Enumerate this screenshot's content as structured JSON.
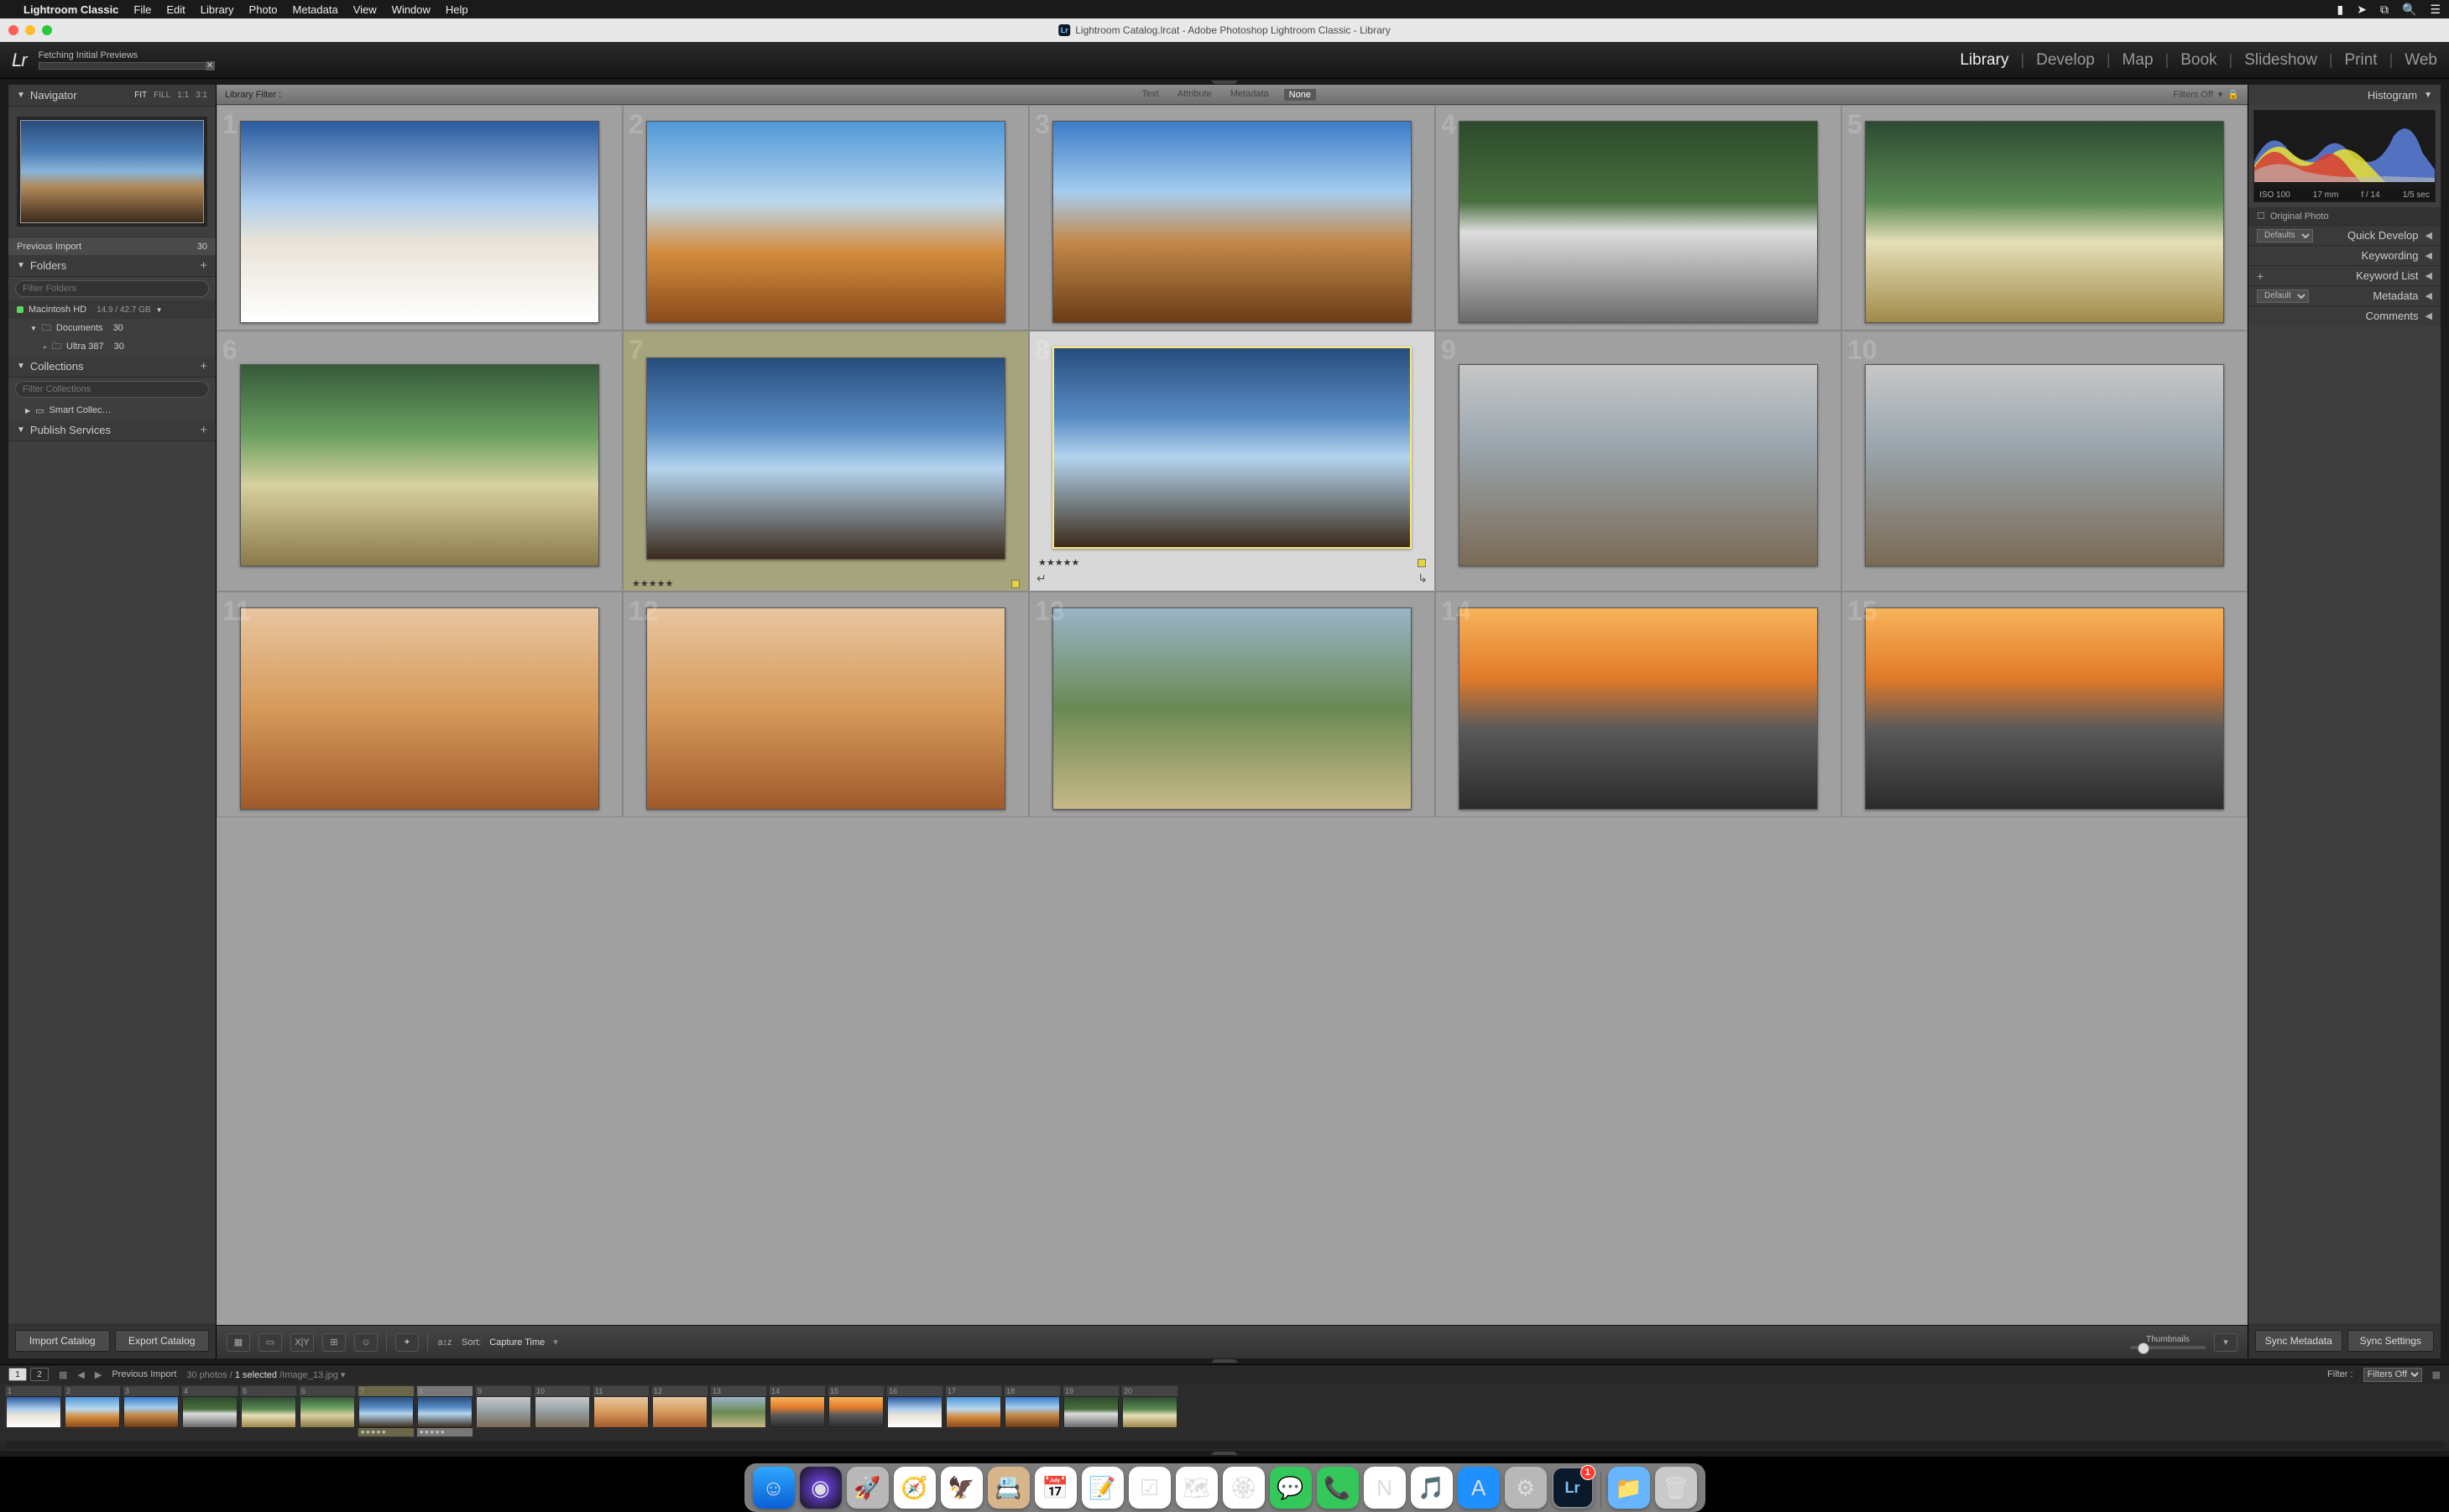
{
  "mac_menu": {
    "app_name": "Lightroom Classic",
    "items": [
      "File",
      "Edit",
      "Library",
      "Photo",
      "Metadata",
      "View",
      "Window",
      "Help"
    ]
  },
  "window_title": "Lightroom Catalog.lrcat - Adobe Photoshop Lightroom Classic - Library",
  "top": {
    "logo": "Lr",
    "progress_label": "Fetching Initial Previews",
    "modules": [
      "Library",
      "Develop",
      "Map",
      "Book",
      "Slideshow",
      "Print",
      "Web"
    ],
    "active_module": "Library"
  },
  "left": {
    "navigator": {
      "title": "Navigator",
      "opts": [
        "FIT",
        "FILL",
        "1:1",
        "3:1"
      ],
      "active": "FIT"
    },
    "previous_import": {
      "label": "Previous Import",
      "count": "30"
    },
    "folders": {
      "title": "Folders",
      "filter_placeholder": "Filter Folders",
      "volume": {
        "name": "Macintosh HD",
        "space": "14.9 / 42.7 GB"
      },
      "items": [
        {
          "name": "Documents",
          "count": "30"
        },
        {
          "name": "Ultra 387",
          "count": "30"
        }
      ]
    },
    "collections": {
      "title": "Collections",
      "filter_placeholder": "Filter Collections",
      "items": [
        "Smart Collec…"
      ]
    },
    "publish": {
      "title": "Publish Services"
    },
    "import_btn": "Import Catalog",
    "export_btn": "Export Catalog"
  },
  "filter_bar": {
    "label": "Library Filter :",
    "tabs": [
      "Text",
      "Attribute",
      "Metadata",
      "None"
    ],
    "active": "None",
    "filters_off": "Filters Off"
  },
  "grid": {
    "stars": "★★★★★",
    "cells_count": 15,
    "selected_index": 8,
    "olive_index": 7
  },
  "toolbar": {
    "sort_label": "Sort:",
    "sort_value": "Capture Time",
    "thumbnails_label": "Thumbnails"
  },
  "right": {
    "histogram": {
      "title": "Histogram",
      "iso": "ISO 100",
      "focal": "17 mm",
      "aperture": "f / 14",
      "shutter": "1/5 sec",
      "original": "Original Photo"
    },
    "quick_develop": {
      "title": "Quick Develop",
      "preset": "Defaults"
    },
    "keywording": "Keywording",
    "keyword_list": "Keyword List",
    "metadata": {
      "title": "Metadata",
      "preset": "Default"
    },
    "comments": "Comments",
    "sync_meta": "Sync Metadata",
    "sync_settings": "Sync Settings"
  },
  "fs": {
    "monitor1": "1",
    "monitor2": "2",
    "collection": "Previous Import",
    "count": "30 photos",
    "selected": "1 selected",
    "filename": "Image_13.jpg",
    "filter_lbl": "Filter :",
    "filter_val": "Filters Off",
    "stars": "★★★★★",
    "count_n": 20
  },
  "dock": {
    "badge": "1",
    "items": [
      {
        "name": "finder",
        "bg": "linear-gradient(#2ea8ff,#0a5fd6)",
        "glyph": "☺"
      },
      {
        "name": "siri",
        "bg": "radial-gradient(circle,#7b49ff,#111)",
        "glyph": "◉"
      },
      {
        "name": "launchpad",
        "bg": "#b8b8b8",
        "glyph": "🚀"
      },
      {
        "name": "safari",
        "bg": "#fff",
        "glyph": "🧭"
      },
      {
        "name": "mail",
        "bg": "#fff",
        "glyph": "🦅"
      },
      {
        "name": "contacts",
        "bg": "#d7b48a",
        "glyph": "📇"
      },
      {
        "name": "calendar",
        "bg": "#fff",
        "glyph": "📅"
      },
      {
        "name": "notes",
        "bg": "#fff",
        "glyph": "📝"
      },
      {
        "name": "reminders",
        "bg": "#fff",
        "glyph": "☑"
      },
      {
        "name": "maps",
        "bg": "#fff",
        "glyph": "🗺"
      },
      {
        "name": "photos",
        "bg": "#fff",
        "glyph": "🏵"
      },
      {
        "name": "messages",
        "bg": "#34c759",
        "glyph": "💬"
      },
      {
        "name": "facetime",
        "bg": "#34c759",
        "glyph": "📞"
      },
      {
        "name": "news",
        "bg": "#fff",
        "glyph": "N"
      },
      {
        "name": "music",
        "bg": "#fff",
        "glyph": "🎵"
      },
      {
        "name": "appstore",
        "bg": "#1e90ff",
        "glyph": "A"
      },
      {
        "name": "settings",
        "bg": "#b8b8b8",
        "glyph": "⚙"
      },
      {
        "name": "lightroom",
        "bg": "#0b1a2b",
        "glyph": "Lr",
        "active": true,
        "badge": true
      },
      {
        "name": "downloads",
        "bg": "#67b4ff",
        "glyph": "📁"
      },
      {
        "name": "trash",
        "bg": "#c9c9c9",
        "glyph": "🗑"
      }
    ]
  }
}
